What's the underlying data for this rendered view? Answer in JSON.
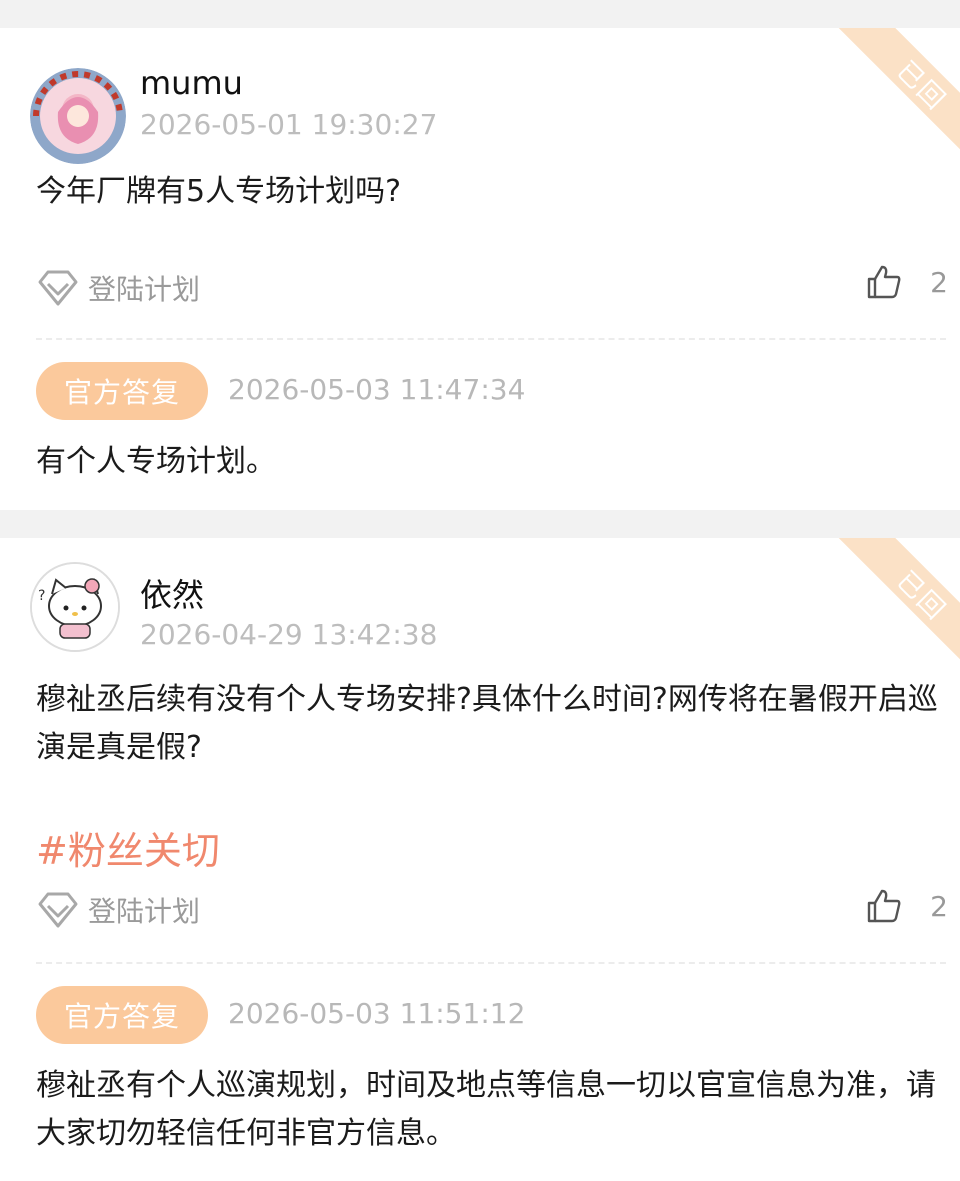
{
  "posts": [
    {
      "username": "mumu",
      "time": "2026-05-01 19:30:27",
      "badge": "已回",
      "content": "今年厂牌有5人专场计划吗?",
      "hashtag": "",
      "tag": "登陆计划",
      "likes": "2",
      "reply": {
        "label": "官方答复",
        "time": "2026-05-03 11:47:34",
        "text": "有个人专场计划。"
      }
    },
    {
      "username": "依然",
      "time": "2026-04-29 13:42:38",
      "badge": "已回",
      "content": "穆祉丞后续有没有个人专场安排?具体什么时间?网传将在暑假开启巡演是真是假?",
      "hashtag": "#粉丝关切",
      "tag": "登陆计划",
      "likes": "2",
      "reply": {
        "label": "官方答复",
        "time": "2026-05-03 11:51:12",
        "text": "穆祉丞有个人巡演规划，时间及地点等信息一切以官宣信息为准，请大家切勿轻信任何非官方信息。"
      }
    }
  ],
  "colors": {
    "official_pill": "#fbc99c",
    "hashtag": "#f0886d",
    "badge": "#fbe1c6",
    "background": "#f2f2f2"
  },
  "icons": [
    "diamond-tag-icon",
    "thumbs-up-icon"
  ]
}
